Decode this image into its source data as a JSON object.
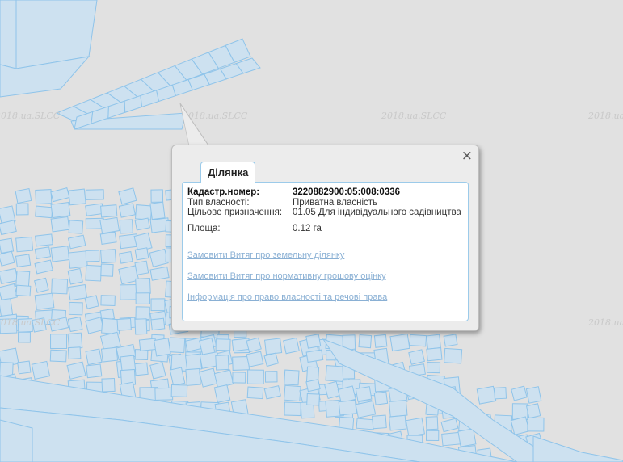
{
  "map": {
    "watermark": "2018.ua.SLCC",
    "background_color": "#e1e1e1",
    "parcel_fill": "#cde1f0",
    "parcel_stroke": "#8fc4ea"
  },
  "popup": {
    "tab_title": "Ділянка",
    "close_symbol": "×",
    "fields": {
      "cadastral_label": "Кадастр.номер:",
      "cadastral_value": "3220882900:05:008:0336",
      "ownership_label": "Тип власності:",
      "ownership_value": "Приватна власність",
      "purpose_label": "Цільове призначення:",
      "purpose_value": "01.05 Для індивідуального садівництва",
      "area_label": "Площа:",
      "area_value": "0.12 га"
    },
    "links": [
      "Замовити Витяг про земельну ділянку",
      "Замовити Витяг про нормативну грошову оцінку",
      "Інформація про право власності та речові права"
    ]
  }
}
